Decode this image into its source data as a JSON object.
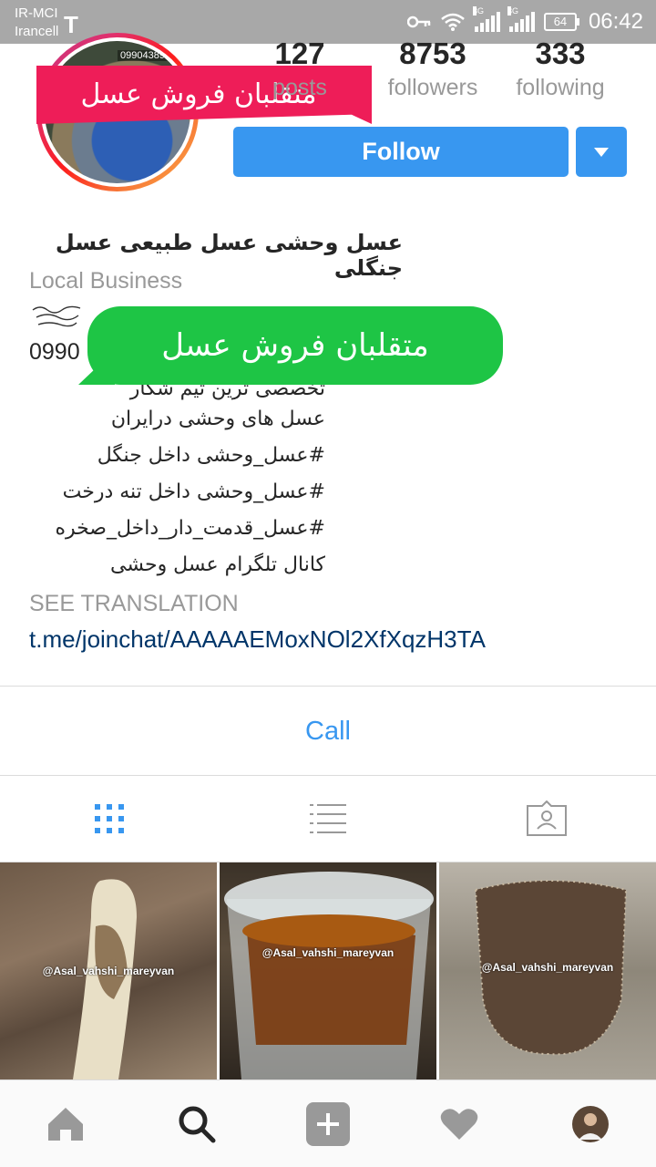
{
  "status_bar": {
    "carrier_1": "IR-MCI",
    "carrier_2": "Irancell",
    "battery": "64",
    "time": "06:42",
    "network_1": "3G",
    "network_2": "3G"
  },
  "overlays": {
    "red_banner": "متقلبان فروش عسل",
    "green_bubble": "متقلبان فروش عسل"
  },
  "profile": {
    "avatar_number": "09904389",
    "stats": [
      {
        "value": "127",
        "label": "posts"
      },
      {
        "value": "8753",
        "label": "followers"
      },
      {
        "value": "333",
        "label": "following"
      }
    ],
    "follow_label": "Follow",
    "display_name": "عسل وحشی  عسل طبیعی  عسل جنگلی",
    "category": "Local Business",
    "phone_fragment": "0990",
    "bio_lines": [
      "تخصصی ترین تیم شکار",
      "عسل های وحشی درایران",
      "#عسل_وحشی داخل جنگل",
      "#عسل_وحشی داخل تنه درخت",
      "#عسل_قدمت_دار_داخل_صخره",
      "کانال تلگرام عسل وحشی"
    ],
    "see_translation": "SEE TRANSLATION",
    "link": "t.me/joinchat/AAAAAEMoxNOl2XfXqzH3TA",
    "call_label": "Call"
  },
  "tabs": [
    {
      "icon": "grid-icon",
      "active": true
    },
    {
      "icon": "list-icon",
      "active": false
    },
    {
      "icon": "tagged-icon",
      "active": false
    }
  ],
  "posts": [
    {
      "watermark": "@Asal_vahshi_mareyvan"
    },
    {
      "watermark": "@Asal_vahshi_mareyvan"
    },
    {
      "watermark": "@Asal_vahshi_mareyvan"
    }
  ],
  "bottom_nav": [
    {
      "icon": "home-icon"
    },
    {
      "icon": "search-icon"
    },
    {
      "icon": "add-icon"
    },
    {
      "icon": "heart-icon"
    },
    {
      "icon": "profile-avatar"
    }
  ],
  "colors": {
    "accent": "#3897f0",
    "red_banner": "#ee1d58",
    "green_bubble": "#1ec545",
    "status_bar": "#a8a8a8"
  }
}
